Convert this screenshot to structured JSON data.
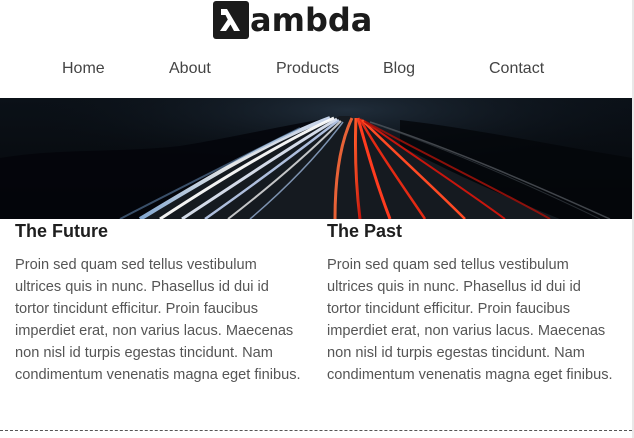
{
  "brand": {
    "logo_text": "ambda",
    "logo_glyph": "λ"
  },
  "nav": {
    "items": [
      {
        "label": "Home"
      },
      {
        "label": "About"
      },
      {
        "label": "Products"
      },
      {
        "label": "Blog"
      },
      {
        "label": "Contact"
      }
    ]
  },
  "hero": {
    "icon": "highway-light-trails-image"
  },
  "columns": [
    {
      "title": "The Future",
      "text": "Proin sed quam sed tellus vestibulum ultrices quis in nunc. Phasellus id dui id tortor tincidunt efficitur. Proin faucibus imperdiet erat, non varius lacus. Maecenas non nisl id turpis egestas tincidunt. Nam condimentum venenatis magna eget finibus."
    },
    {
      "title": "The Past",
      "text": "Proin sed quam sed tellus vestibulum ultrices quis in nunc. Phasellus id dui id tortor tincidunt efficitur. Proin faucibus imperdiet erat, non varius lacus. Maecenas non nisl id turpis egestas tincidunt. Nam condimentum venenatis magna eget finibus."
    }
  ]
}
